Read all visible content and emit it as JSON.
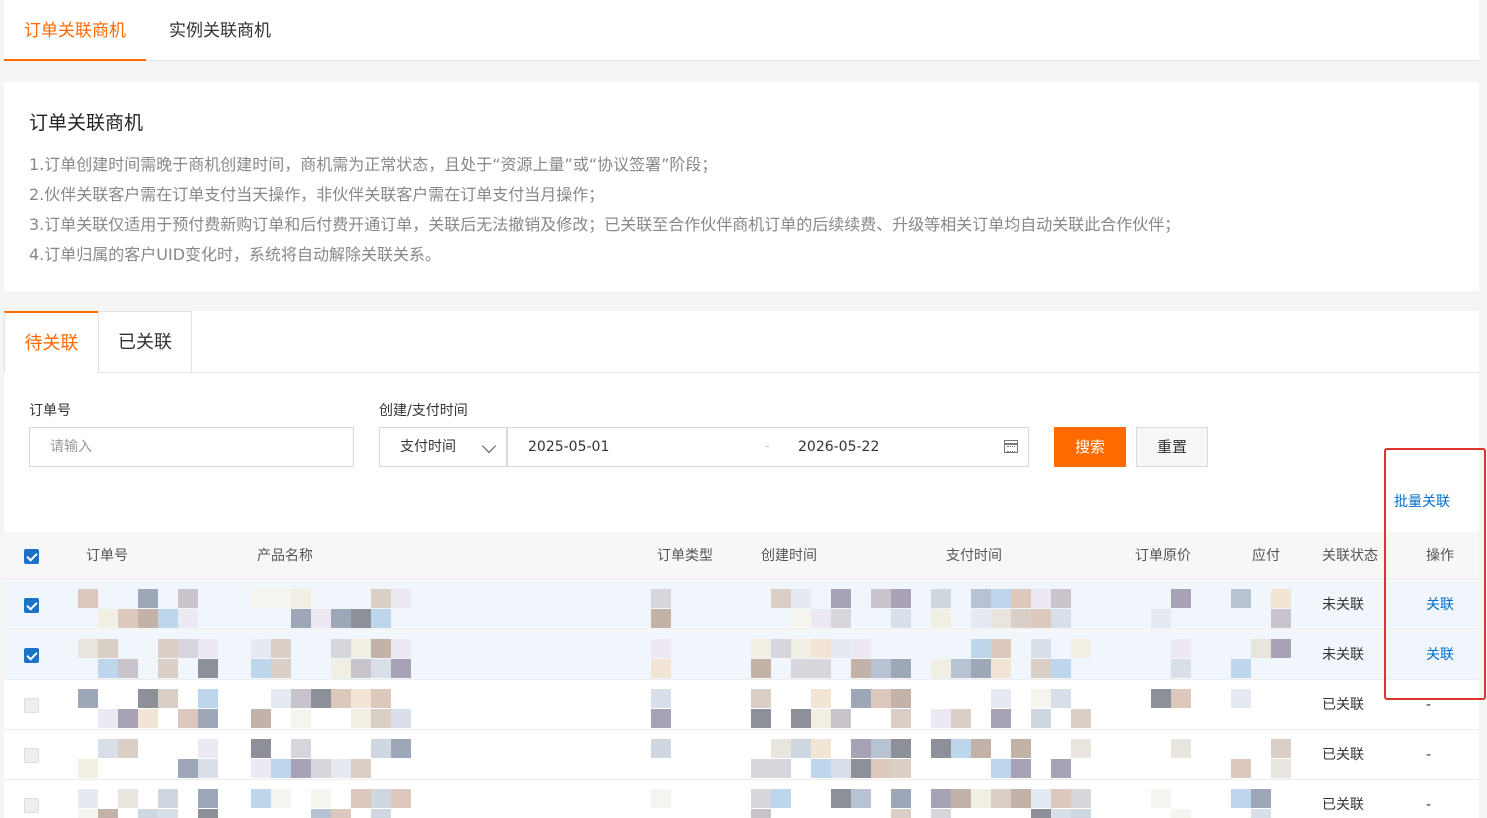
{
  "top_tabs": [
    "订单关联商机",
    "实例关联商机"
  ],
  "notice": {
    "title": "订单关联商机",
    "rules": [
      "1.订单创建时间需晚于商机创建时间，商机需为正常状态，且处于“资源上量”或“协议签署”阶段；",
      "2.伙伴关联客户需在订单支付当天操作，非伙伴关联客户需在订单支付当月操作；",
      "3.订单关联仅适用于预付费新购订单和后付费开通订单，关联后无法撤销及修改；已关联至合作伙伴商机订单的后续续费、升级等相关订单均自动关联此合作伙伴；",
      "4.订单归属的客户UID变化时，系统将自动解除关联关系。"
    ]
  },
  "sub_tabs": [
    "待关联",
    "已关联"
  ],
  "filters": {
    "order_no_label": "订单号",
    "order_no_placeholder": "请输入",
    "time_label": "创建/支付时间",
    "time_type": "支付时间",
    "start_date": "2025-05-01",
    "separator": "-",
    "end_date": "2026-05-22",
    "search_button": "搜索",
    "reset_button": "重置"
  },
  "batch_link": "批量关联",
  "table": {
    "columns": [
      "订单号",
      "产品名称",
      "订单类型",
      "创建时间",
      "支付时间",
      "订单原价",
      "应付",
      "关联状态",
      "操作"
    ],
    "rows": [
      {
        "checked": true,
        "status": "未关联",
        "action": "关联"
      },
      {
        "checked": true,
        "status": "未关联",
        "action": "关联"
      },
      {
        "checked": false,
        "status": "已关联",
        "action": "-"
      },
      {
        "checked": false,
        "status": "已关联",
        "action": "-"
      },
      {
        "checked": false,
        "status": "已关联",
        "action": "-"
      }
    ]
  },
  "colors": {
    "accent": "#ff6a00",
    "link": "#0070cc",
    "highlight_border": "#e0342b"
  }
}
